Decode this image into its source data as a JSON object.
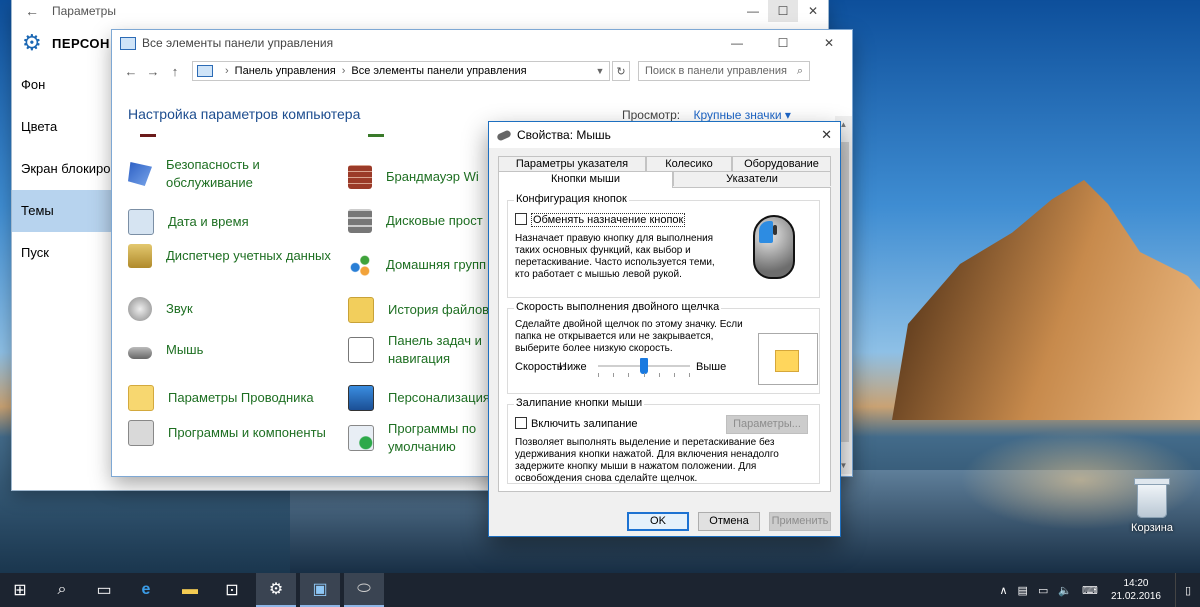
{
  "settings": {
    "title": "Параметры",
    "header_title": "ПЕРСОН",
    "nav": [
      "Фон",
      "Цвета",
      "Экран блокиро",
      "Темы",
      "Пуск"
    ],
    "selected_nav_index": 3
  },
  "control_panel": {
    "title": "Все элементы панели управления",
    "breadcrumb": [
      "Панель управления",
      "Все элементы панели управления"
    ],
    "search_placeholder": "Поиск в панели управления",
    "heading": "Настройка параметров компьютера",
    "view_label": "Просмотр:",
    "view_value": "Крупные значки",
    "items_left": [
      "Безопасность и обслуживание",
      "Дата и время",
      "Диспетчер учетных данных",
      "Звук",
      "Мышь",
      "Параметры Проводника",
      "Программы и компоненты"
    ],
    "items_right": [
      "Брандмауэр Wi",
      "Дисковые прост",
      "Домашняя групп",
      "История файлов",
      "Панель задач и навигация",
      "Персонализация",
      "Программы по умолчанию"
    ]
  },
  "mouse_dialog": {
    "title": "Свойства: Мышь",
    "tabs_top": [
      "Параметры указателя",
      "Колесико",
      "Оборудование"
    ],
    "tabs_bottom": [
      "Кнопки мыши",
      "Указатели"
    ],
    "active_tab": "Кнопки мыши",
    "button_config": {
      "title": "Конфигурация кнопок",
      "checkbox_label": "Обменять назначение кнопок",
      "checked": false,
      "description": "Назначает правую кнопку для выполнения таких основных функций, как выбор и перетаскивание. Часто используется теми, кто работает с мышью левой рукой."
    },
    "double_click": {
      "title": "Скорость выполнения двойного щелчка",
      "description": "Сделайте двойной щелчок по этому значку. Если папка не открывается или не закрывается, выберите более низкую скорость.",
      "speed_label": "Скорость:",
      "low": "Ниже",
      "high": "Выше",
      "speed_fraction": 0.5
    },
    "click_lock": {
      "title": "Залипание кнопки мыши",
      "checkbox_label": "Включить залипание",
      "checked": false,
      "settings_button": "Параметры...",
      "description": "Позволяет выполнять выделение и перетаскивание без удерживания кнопки нажатой. Для включения ненадолго задержите кнопку мыши в нажатом положении. Для освобождения снова сделайте щелчок."
    },
    "buttons": {
      "ok": "OK",
      "cancel": "Отмена",
      "apply": "Применить"
    }
  },
  "desktop": {
    "recycle_bin": "Корзина"
  },
  "taskbar": {
    "time": "14:20",
    "date": "21.02.2016"
  }
}
